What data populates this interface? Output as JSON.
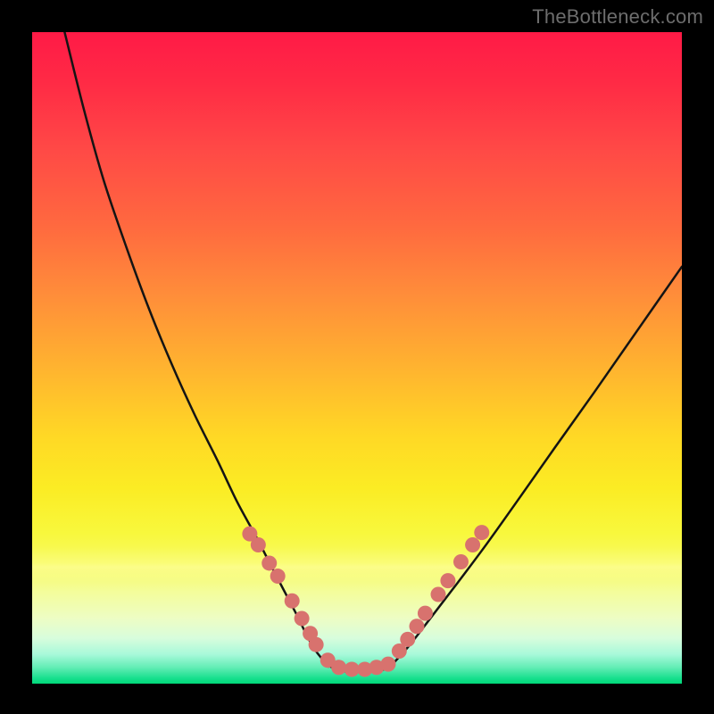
{
  "watermark": {
    "text": "TheBottleneck.com"
  },
  "colors": {
    "curve_stroke": "#141414",
    "marker_fill": "#d8726e",
    "marker_stroke": "#d8726e",
    "background_black": "#000000"
  },
  "chart_data": {
    "type": "line",
    "title": "",
    "xlabel": "",
    "ylabel": "",
    "xlim": [
      0,
      1
    ],
    "ylim": [
      0,
      1
    ],
    "notes": "V-shaped bottleneck curve with a flat minimum (green zone ≈ 0 bottleneck) and steep rise on both sides (red zone ≈ high bottleneck). Markers cluster near the minimum on both arms.",
    "series": [
      {
        "name": "left_arm",
        "x": [
          0.05,
          0.08,
          0.11,
          0.145,
          0.18,
          0.215,
          0.25,
          0.285,
          0.315,
          0.345,
          0.375,
          0.405,
          0.432,
          0.455
        ],
        "y": [
          1.0,
          0.88,
          0.773,
          0.67,
          0.575,
          0.49,
          0.413,
          0.343,
          0.28,
          0.225,
          0.167,
          0.11,
          0.057,
          0.028
        ]
      },
      {
        "name": "flat_minimum",
        "x": [
          0.455,
          0.475,
          0.495,
          0.515,
          0.535,
          0.55
        ],
        "y": [
          0.028,
          0.02,
          0.018,
          0.018,
          0.02,
          0.025
        ]
      },
      {
        "name": "right_arm",
        "x": [
          0.55,
          0.58,
          0.615,
          0.655,
          0.7,
          0.75,
          0.805,
          0.865,
          0.93,
          1.0
        ],
        "y": [
          0.025,
          0.058,
          0.103,
          0.155,
          0.215,
          0.285,
          0.363,
          0.447,
          0.54,
          0.64
        ]
      }
    ],
    "markers": [
      {
        "x": 0.335,
        "y": 0.23
      },
      {
        "x": 0.348,
        "y": 0.213
      },
      {
        "x": 0.365,
        "y": 0.185
      },
      {
        "x": 0.378,
        "y": 0.165
      },
      {
        "x": 0.4,
        "y": 0.127
      },
      {
        "x": 0.415,
        "y": 0.1
      },
      {
        "x": 0.428,
        "y": 0.077
      },
      {
        "x": 0.437,
        "y": 0.06
      },
      {
        "x": 0.455,
        "y": 0.036
      },
      {
        "x": 0.472,
        "y": 0.025
      },
      {
        "x": 0.492,
        "y": 0.022
      },
      {
        "x": 0.512,
        "y": 0.022
      },
      {
        "x": 0.53,
        "y": 0.025
      },
      {
        "x": 0.548,
        "y": 0.03
      },
      {
        "x": 0.565,
        "y": 0.05
      },
      {
        "x": 0.578,
        "y": 0.068
      },
      {
        "x": 0.592,
        "y": 0.088
      },
      {
        "x": 0.605,
        "y": 0.108
      },
      {
        "x": 0.625,
        "y": 0.137
      },
      {
        "x": 0.64,
        "y": 0.158
      },
      {
        "x": 0.66,
        "y": 0.187
      },
      {
        "x": 0.678,
        "y": 0.213
      },
      {
        "x": 0.692,
        "y": 0.232
      }
    ]
  }
}
